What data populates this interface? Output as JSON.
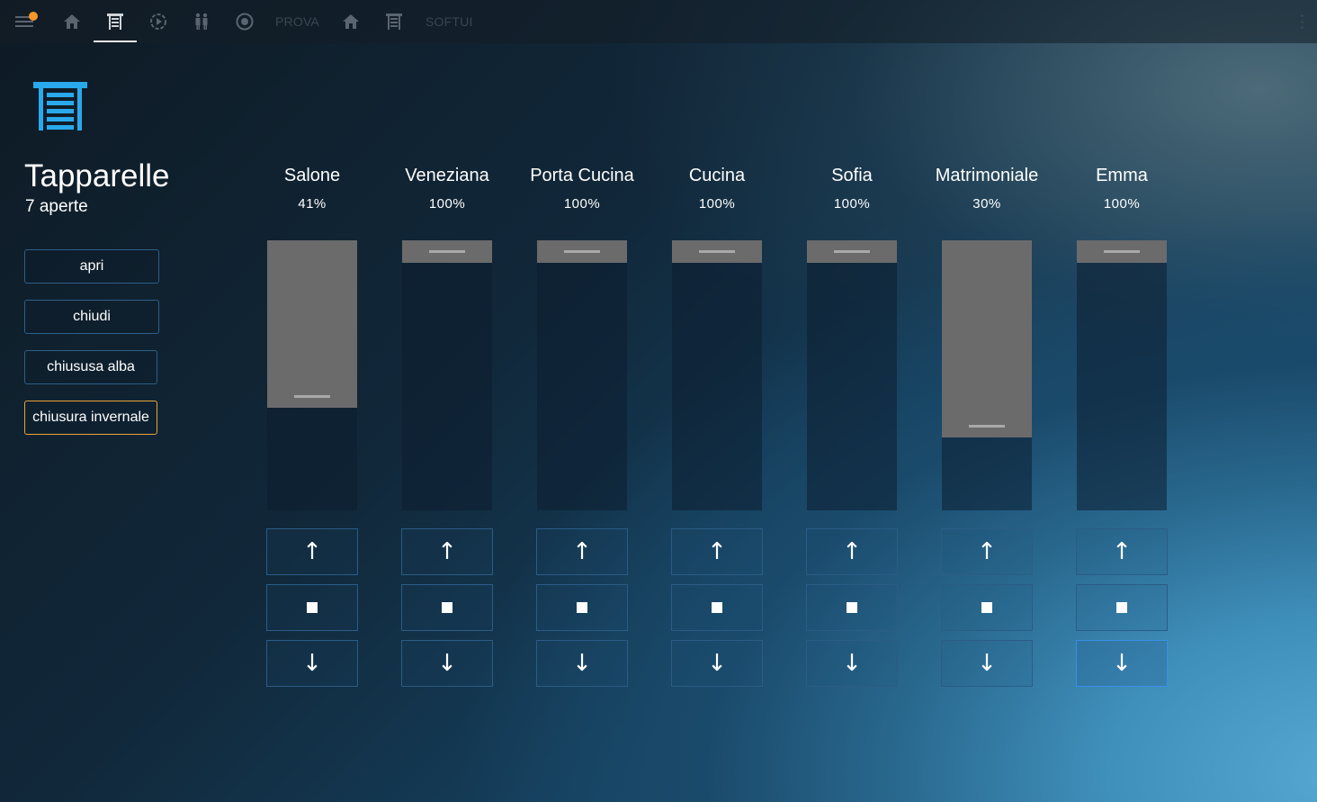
{
  "topbar": {
    "items": [
      {
        "name": "menu-icon",
        "type": "icon"
      },
      {
        "name": "home-icon",
        "type": "icon"
      },
      {
        "name": "shutter-icon",
        "type": "icon",
        "active": true
      },
      {
        "name": "scene-play-icon",
        "type": "icon"
      },
      {
        "name": "people-icon",
        "type": "icon"
      },
      {
        "name": "camera-icon",
        "type": "icon"
      },
      {
        "name": "tab-prova",
        "type": "text",
        "label": "PROVA"
      },
      {
        "name": "home-icon-2",
        "type": "icon"
      },
      {
        "name": "shutter-icon-2",
        "type": "icon"
      },
      {
        "name": "tab-softui",
        "type": "text",
        "label": "SOFTUI"
      }
    ],
    "notification_color": "#f5962a"
  },
  "page": {
    "title": "Tapparelle",
    "subtitle": "7 aperte",
    "icon": "shutter-icon",
    "accent": "#29a9ec"
  },
  "scenes": [
    {
      "label": "apri",
      "active": false
    },
    {
      "label": "chiudi",
      "active": false
    },
    {
      "label": "chiususa alba",
      "active": false
    },
    {
      "label": "chiusura invernale",
      "active": true
    }
  ],
  "shutters": [
    {
      "name": "Salone",
      "percent_label": "41%",
      "closed_fraction": 0.62
    },
    {
      "name": "Veneziana",
      "percent_label": "100%",
      "closed_fraction": 0.0
    },
    {
      "name": "Porta Cucina",
      "percent_label": "100%",
      "closed_fraction": 0.0
    },
    {
      "name": "Cucina",
      "percent_label": "100%",
      "closed_fraction": 0.0
    },
    {
      "name": "Sofia",
      "percent_label": "100%",
      "closed_fraction": 0.0
    },
    {
      "name": "Matrimoniale",
      "percent_label": "30%",
      "closed_fraction": 0.73
    },
    {
      "name": "Emma",
      "percent_label": "100%",
      "closed_fraction": 0.0
    }
  ],
  "controls": {
    "up_symbol": "↑",
    "down_symbol": "↓"
  }
}
